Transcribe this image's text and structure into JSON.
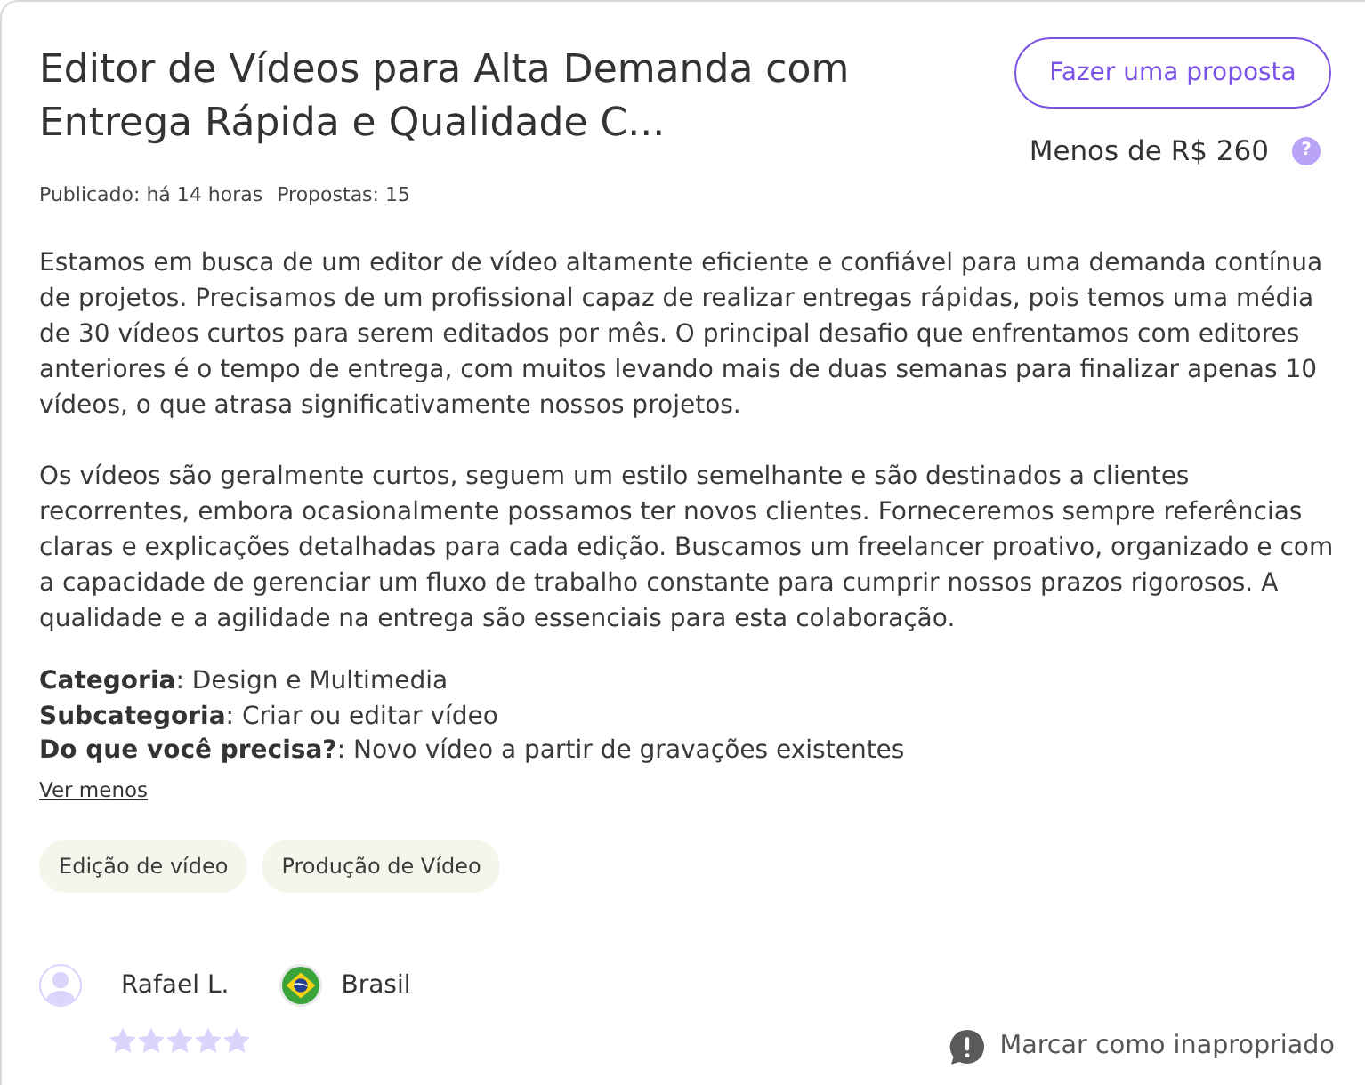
{
  "header": {
    "title": "Editor de Vídeos para Alta Demanda com Entrega Rápida e Qualidade C...",
    "published": "Publicado: há 14 horas",
    "proposals": "Propostas: 15"
  },
  "offer": {
    "button": "Fazer uma proposta",
    "budget": "Menos de R$ 260",
    "help": "?"
  },
  "description": [
    "Estamos em busca de um editor de vídeo altamente eficiente e confiável para uma demanda contínua de projetos. Precisamos de um profissional capaz de realizar entregas rápidas, pois temos uma média de 30 vídeos curtos para serem editados por mês. O principal desafio que enfrentamos com editores anteriores é o tempo de entrega, com muitos levando mais de duas semanas para finalizar apenas 10 vídeos, o que atrasa significativamente nossos projetos.",
    "Os vídeos são geralmente curtos, seguem um estilo semelhante e são destinados a clientes recorrentes, embora ocasionalmente possamos ter novos clientes. Forneceremos sempre referências claras e explicações detalhadas para cada edição. Buscamos um freelancer proativo, organizado e com a capacidade de gerenciar um fluxo de trabalho constante para cumprir nossos prazos rigorosos. A qualidade e a agilidade na entrega são essenciais para esta colaboração."
  ],
  "details": [
    "**Categoria**: Design e Multimedia",
    "**Subcategoria**: Criar ou editar vídeo",
    "**Do que você precisa?**: Novo vídeo a partir de gravações existentes"
  ],
  "toggle_link": "Ver menos",
  "skills": [
    "Edição de vídeo",
    "Produção de Vídeo"
  ],
  "client": {
    "name": "Rafael L.",
    "country": "Brasil",
    "stars": 5
  },
  "report": "Marcar como inapropriado"
}
